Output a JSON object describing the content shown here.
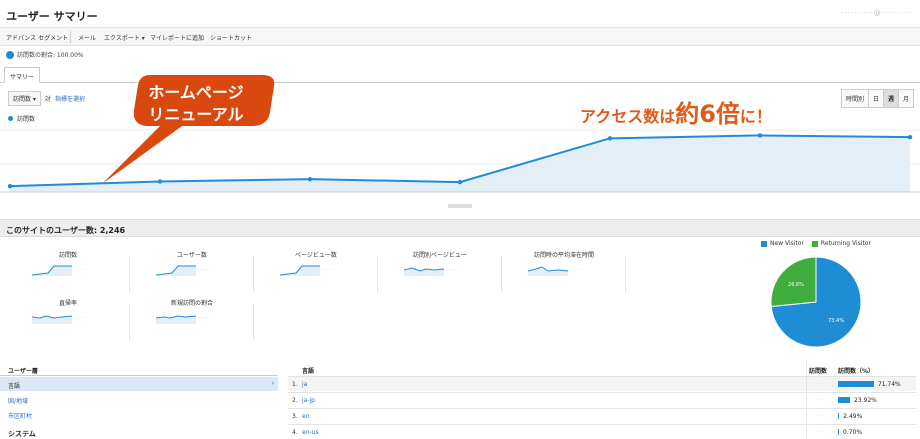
{
  "header": {
    "title": "ユーザー サマリー",
    "account": "··········@··········"
  },
  "toolbar": {
    "items": [
      "アドバンス セグメント",
      "メール",
      "エクスポート ▾",
      "マイレポートに追加",
      "ショートカット"
    ]
  },
  "segment": {
    "label": "訪問数の割合: 100.00%"
  },
  "tabs": {
    "summary": "サマリー"
  },
  "controls": {
    "metric": "訪問数 ▾",
    "vs": "対",
    "pick": "指標を選択"
  },
  "period": {
    "options": [
      "時間別",
      "日",
      "週",
      "月"
    ],
    "active": "週"
  },
  "chart": {
    "legend": "訪問数"
  },
  "chart_data": {
    "type": "area",
    "series": [
      {
        "name": "訪問数",
        "values": [
          10,
          18,
          22,
          17,
          92,
          97,
          94
        ]
      }
    ],
    "x": [
      0,
      1,
      2,
      3,
      4,
      5,
      6
    ],
    "ylim": [
      0,
      120
    ],
    "color": "#1f8dd6",
    "fill": "#e3eef7"
  },
  "annotations": {
    "callout_line1": "ホームページ",
    "callout_line2": "リニューアル",
    "headline_prefix": "アクセス数は",
    "headline_big": "約6倍",
    "headline_suffix": "に！",
    "callout_color": "#d9490f",
    "headline_color": "#e05a1a"
  },
  "summary": {
    "title": "このサイトのユーザー数: 2,246"
  },
  "metrics": [
    {
      "label": "訪問数"
    },
    {
      "label": "ユーザー数"
    },
    {
      "label": "ページビュー数"
    },
    {
      "label": "訪問別ページビュー"
    },
    {
      "label": "訪問時の平均滞在時間"
    },
    {
      "label": "直帰率"
    },
    {
      "label": "新規訪問の割合"
    }
  ],
  "pie": {
    "new_label": "New Visitor",
    "returning_label": "Returning Visitor",
    "new_pct": "73.4%",
    "returning_pct": "26.6%",
    "new_value": 73.4,
    "returning_value": 26.6,
    "new_color": "#1f8dd6",
    "returning_color": "#3fae3f"
  },
  "left_nav": {
    "heading": "ユーザー層",
    "items": [
      "言語",
      "国/地域",
      "市区町村"
    ],
    "system": "システム"
  },
  "table": {
    "col_lang": "言語",
    "col_visits": "訪問数",
    "col_pct": "訪問数（%）",
    "rows": [
      {
        "num": "1.",
        "lang": "ja",
        "pct": "71.74%",
        "value": 71.74
      },
      {
        "num": "2.",
        "lang": "ja-jp",
        "pct": "23.92%",
        "value": 23.92
      },
      {
        "num": "3.",
        "lang": "en",
        "pct": "2.49%",
        "value": 2.49
      },
      {
        "num": "4.",
        "lang": "en-us",
        "pct": "0.70%",
        "value": 0.7
      }
    ]
  }
}
